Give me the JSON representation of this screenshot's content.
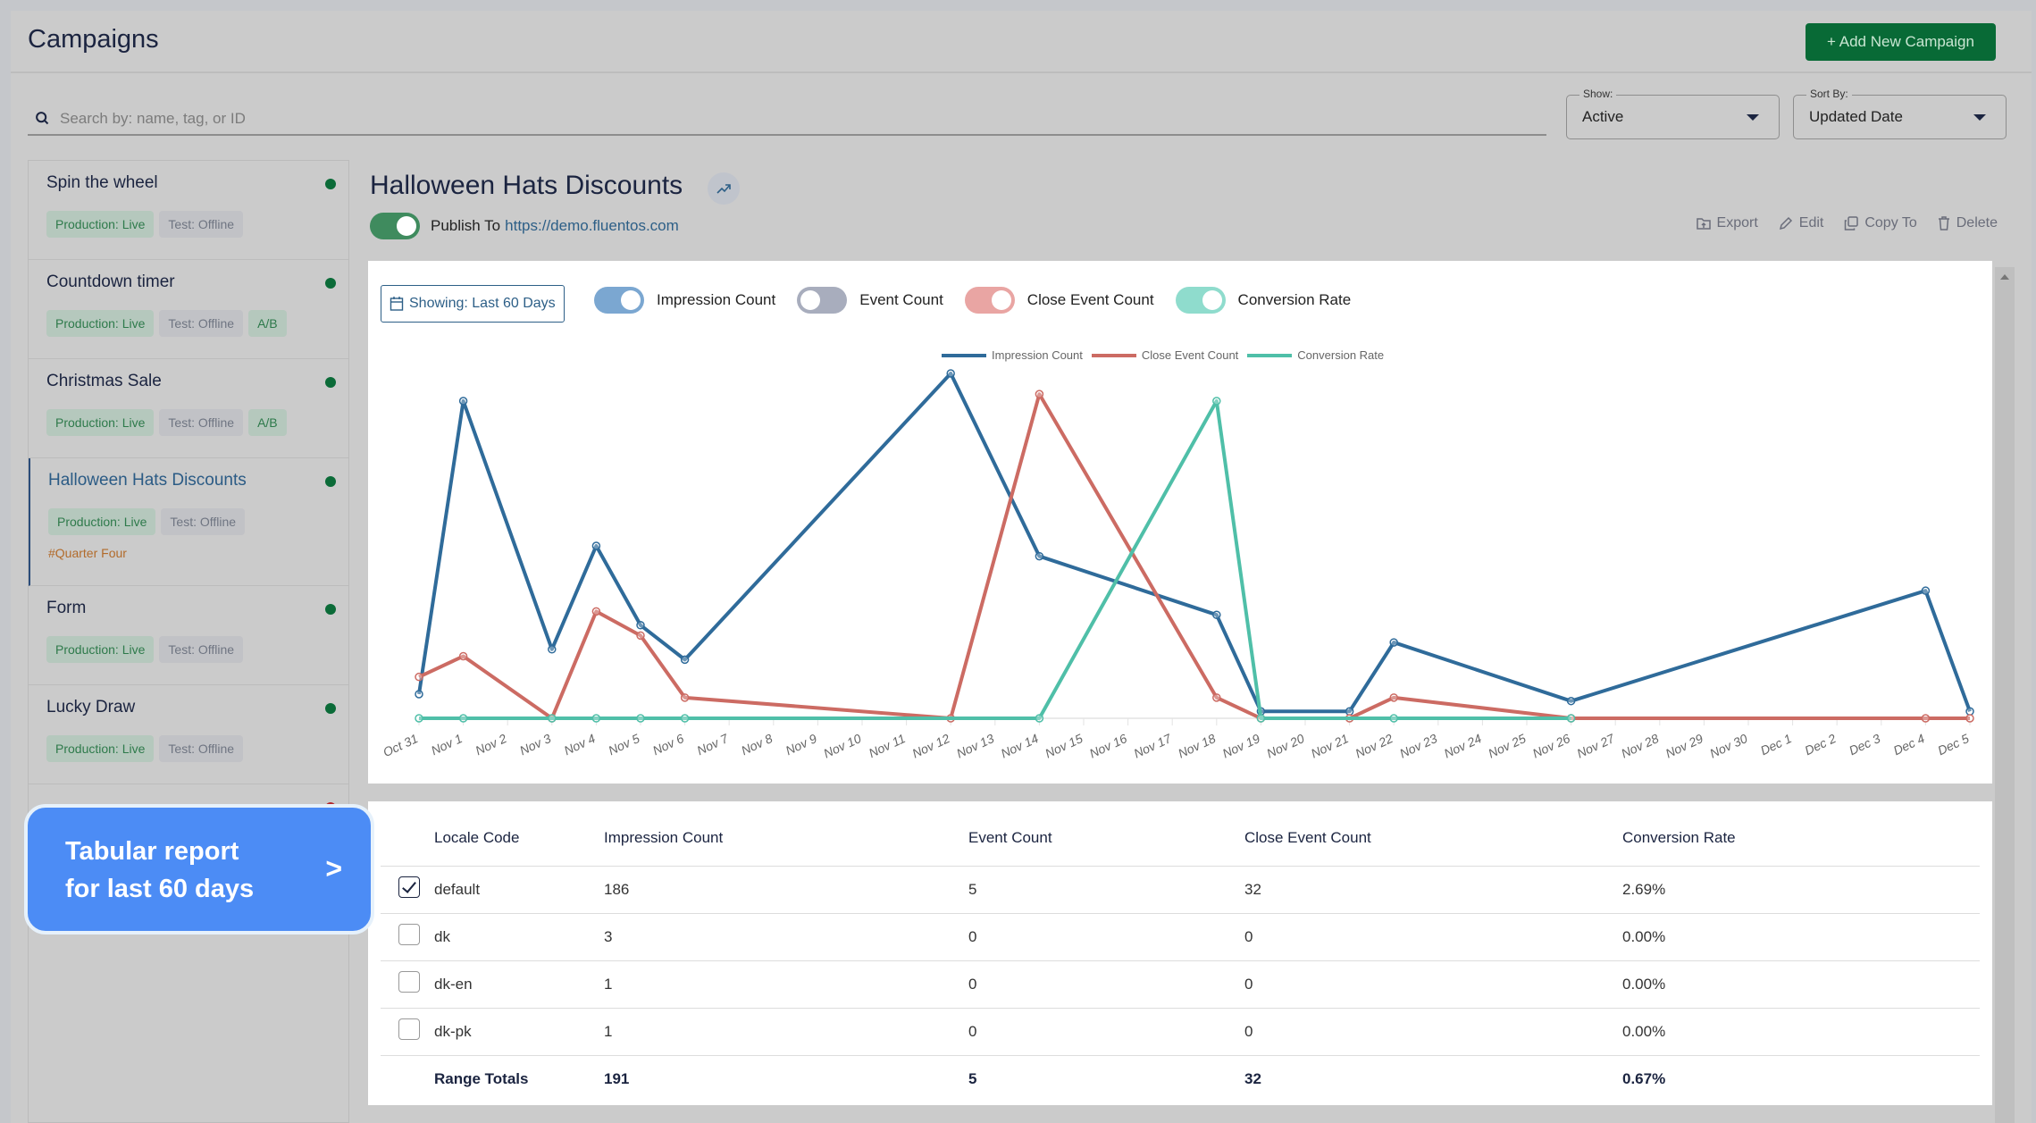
{
  "header": {
    "title": "Campaigns",
    "add_button": "+ Add New Campaign",
    "search_placeholder": "Search by: name, tag, or ID",
    "show": {
      "label": "Show:",
      "value": "Active"
    },
    "sort": {
      "label": "Sort By:",
      "value": "Updated Date"
    }
  },
  "sidebar": {
    "campaigns": [
      {
        "name": "Spin the wheel",
        "status": "live",
        "tags": [
          "Production: Live",
          "Test: Offline"
        ]
      },
      {
        "name": "Countdown timer",
        "status": "live",
        "tags": [
          "Production: Live",
          "Test: Offline",
          "A/B"
        ]
      },
      {
        "name": "Christmas Sale",
        "status": "live",
        "tags": [
          "Production: Live",
          "Test: Offline",
          "A/B"
        ]
      },
      {
        "name": "Halloween Hats Discounts",
        "status": "live",
        "active": true,
        "tags": [
          "Production: Live",
          "Test: Offline"
        ],
        "hashtag": "#Quarter Four"
      },
      {
        "name": "Form",
        "status": "live",
        "tags": [
          "Production: Live",
          "Test: Offline"
        ]
      },
      {
        "name": "Lucky Draw",
        "status": "live",
        "tags": [
          "Production: Live",
          "Test: Offline"
        ]
      }
    ],
    "status_colors": {
      "live": "#0b6b38",
      "offline": "#b3262b"
    }
  },
  "detail": {
    "title": "Halloween Hats Discounts",
    "publish_label": "Publish To",
    "publish_url": "https://demo.fluentos.com",
    "publish_enabled": true,
    "actions": {
      "export": "Export",
      "edit": "Edit",
      "copy": "Copy To",
      "delete": "Delete"
    },
    "range_button": "Showing: Last 60 Days",
    "series_toggles": [
      {
        "label": "Impression Count",
        "on": true,
        "color": "#7ba7d1"
      },
      {
        "label": "Event Count",
        "on": false,
        "color": "#a8adbd"
      },
      {
        "label": "Close Event Count",
        "on": true,
        "color": "#e9a5a3"
      },
      {
        "label": "Conversion Rate",
        "on": true,
        "color": "#8fdccd"
      }
    ]
  },
  "chart_data": {
    "type": "line",
    "title": "",
    "xlabel": "",
    "ylabel": "",
    "y_axis_visible": false,
    "y_units": "normalized per series (% of series peak)",
    "ylim": [
      0,
      100
    ],
    "grid": false,
    "legend_position": "top-center",
    "x": [
      "Oct 31",
      "Nov 1",
      "Nov 2",
      "Nov 3",
      "Nov 4",
      "Nov 5",
      "Nov 6",
      "Nov 7",
      "Nov 8",
      "Nov 9",
      "Nov 10",
      "Nov 11",
      "Nov 12",
      "Nov 13",
      "Nov 14",
      "Nov 15",
      "Nov 16",
      "Nov 17",
      "Nov 18",
      "Nov 19",
      "Nov 20",
      "Nov 21",
      "Nov 22",
      "Nov 23",
      "Nov 24",
      "Nov 25",
      "Nov 26",
      "Nov 27",
      "Nov 28",
      "Nov 29",
      "Nov 30",
      "Dec 1",
      "Dec 2",
      "Dec 3",
      "Dec 4",
      "Dec 5"
    ],
    "series": [
      {
        "name": "Impression Count",
        "color": "#2f6b9a",
        "points": [
          [
            "Oct 31",
            7
          ],
          [
            "Nov 1",
            92
          ],
          [
            "Nov 3",
            20
          ],
          [
            "Nov 4",
            50
          ],
          [
            "Nov 5",
            27
          ],
          [
            "Nov 6",
            17
          ],
          [
            "Nov 12",
            100
          ],
          [
            "Nov 14",
            47
          ],
          [
            "Nov 18",
            30
          ],
          [
            "Nov 19",
            2
          ],
          [
            "Nov 21",
            2
          ],
          [
            "Nov 22",
            22
          ],
          [
            "Nov 26",
            5
          ],
          [
            "Dec 4",
            37
          ],
          [
            "Dec 5",
            2
          ]
        ]
      },
      {
        "name": "Close Event Count",
        "color": "#cc6b63",
        "points": [
          [
            "Oct 31",
            12
          ],
          [
            "Nov 1",
            18
          ],
          [
            "Nov 3",
            0
          ],
          [
            "Nov 4",
            31
          ],
          [
            "Nov 5",
            24
          ],
          [
            "Nov 6",
            6
          ],
          [
            "Nov 12",
            0
          ],
          [
            "Nov 14",
            94
          ],
          [
            "Nov 18",
            6
          ],
          [
            "Nov 19",
            0
          ],
          [
            "Nov 21",
            0
          ],
          [
            "Nov 22",
            6
          ],
          [
            "Nov 26",
            0
          ],
          [
            "Dec 4",
            0
          ],
          [
            "Dec 5",
            0
          ]
        ]
      },
      {
        "name": "Conversion Rate",
        "color": "#4fbfa8",
        "points": [
          [
            "Oct 31",
            0
          ],
          [
            "Nov 1",
            0
          ],
          [
            "Nov 3",
            0
          ],
          [
            "Nov 4",
            0
          ],
          [
            "Nov 5",
            0
          ],
          [
            "Nov 6",
            0
          ],
          [
            "Nov 14",
            0
          ],
          [
            "Nov 18",
            92
          ],
          [
            "Nov 19",
            0
          ],
          [
            "Nov 22",
            0
          ],
          [
            "Nov 26",
            0
          ]
        ]
      }
    ]
  },
  "table": {
    "columns": [
      "",
      "Locale Code",
      "Impression Count",
      "Event Count",
      "Close Event Count",
      "Conversion Rate"
    ],
    "rows": [
      {
        "checked": true,
        "locale": "default",
        "impressions": "186",
        "events": "5",
        "close_events": "32",
        "conversion": "2.69%"
      },
      {
        "checked": false,
        "locale": "dk",
        "impressions": "3",
        "events": "0",
        "close_events": "0",
        "conversion": "0.00%"
      },
      {
        "checked": false,
        "locale": "dk-en",
        "impressions": "1",
        "events": "0",
        "close_events": "0",
        "conversion": "0.00%"
      },
      {
        "checked": false,
        "locale": "dk-pk",
        "impressions": "1",
        "events": "0",
        "close_events": "0",
        "conversion": "0.00%"
      }
    ],
    "totals": {
      "label": "Range Totals",
      "impressions": "191",
      "events": "5",
      "close_events": "32",
      "conversion": "0.67%"
    }
  },
  "callout": {
    "text": "Tabular report\nfor last 60 days",
    "arrow": ">"
  }
}
